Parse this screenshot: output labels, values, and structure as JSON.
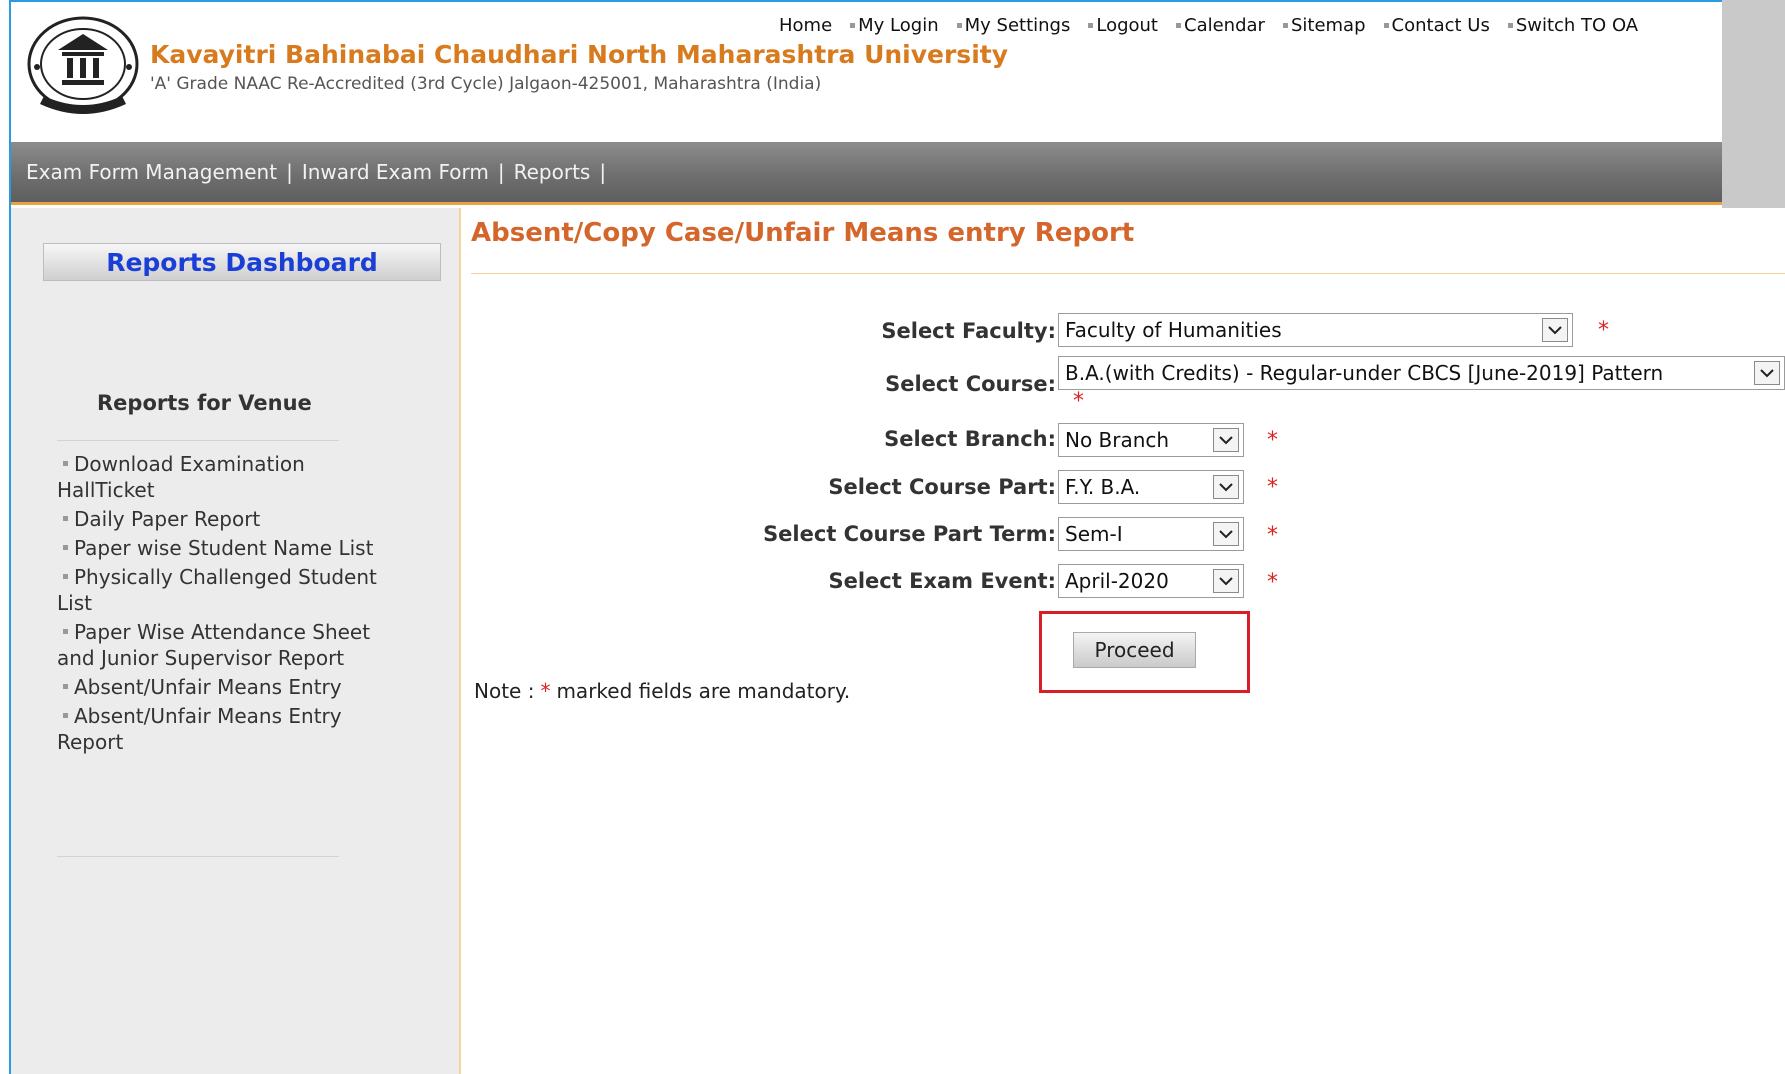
{
  "header": {
    "title": "Kavayitri Bahinabai Chaudhari North Maharashtra University",
    "subtitle": "'A' Grade NAAC Re-Accredited (3rd Cycle) Jalgaon-425001, Maharashtra (India)"
  },
  "top_links": [
    "Home",
    "My Login",
    "My Settings",
    "Logout",
    "Calendar",
    "Sitemap",
    "Contact Us",
    "Switch TO OA"
  ],
  "nav": {
    "items": [
      "Exam Form Management",
      "Inward Exam Form",
      "Reports"
    ],
    "separator": "|"
  },
  "sidebar": {
    "dashboard_label": "Reports Dashboard",
    "section_heading": "Reports for Venue",
    "items": [
      "Download Examination HallTicket",
      "Daily Paper Report",
      "Paper wise Student Name List",
      "Physically Challenged Student List",
      "Paper Wise Attendance Sheet and Junior Supervisor Report",
      "Absent/Unfair Means Entry",
      "Absent/Unfair Means Entry Report"
    ]
  },
  "main": {
    "title": "Absent/Copy Case/Unfair Means entry Report",
    "form": {
      "faculty": {
        "label": "Select Faculty:",
        "value": "Faculty of Humanities"
      },
      "course": {
        "label": "Select Course:",
        "value": "B.A.(with Credits) - Regular-under CBCS [June-2019] Pattern"
      },
      "branch": {
        "label": "Select Branch:",
        "value": "No Branch"
      },
      "course_part": {
        "label": "Select Course Part:",
        "value": "F.Y. B.A."
      },
      "course_part_term": {
        "label": "Select Course Part Term:",
        "value": "Sem-I"
      },
      "exam_event": {
        "label": "Select Exam Event:",
        "value": "April-2020"
      }
    },
    "required_marker": "*",
    "proceed_label": "Proceed",
    "note_prefix": "Note :",
    "note_star": "*",
    "note_text": "marked fields are mandatory."
  },
  "colors": {
    "title_orange": "#d87a1e",
    "report_title": "#d4652b",
    "dashboard_blue": "#1a3fd6",
    "highlight_red": "#d81e26"
  }
}
